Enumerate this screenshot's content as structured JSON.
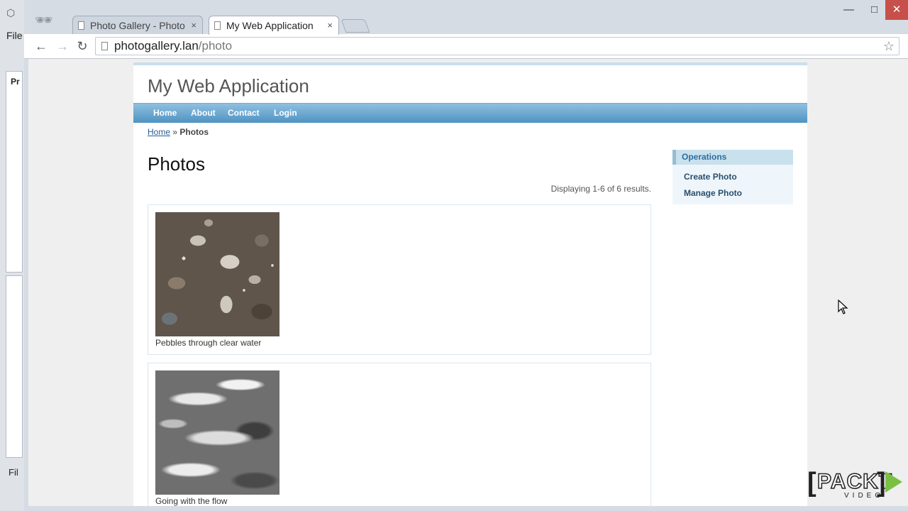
{
  "background_app": {
    "menu_file": "File",
    "panel_label": "Pr",
    "bottom_label": "Fil"
  },
  "browser": {
    "tabs": [
      {
        "title": "Photo Gallery - Photo",
        "active": false
      },
      {
        "title": "My Web Application",
        "active": true
      }
    ],
    "tab_close": "×",
    "url_host": "photogallery.lan",
    "url_path": "/photo"
  },
  "site": {
    "title": "My Web Application",
    "menu": [
      "Home",
      "About",
      "Contact",
      "Login"
    ],
    "breadcrumb": {
      "home": "Home",
      "separator": "»",
      "current": "Photos"
    }
  },
  "content": {
    "heading": "Photos",
    "summary": "Displaying 1-6 of 6 results.",
    "photos": [
      {
        "caption": "Pebbles through clear water"
      },
      {
        "caption": "Going with the flow"
      }
    ]
  },
  "sidebar": {
    "title": "Operations",
    "items": [
      "Create Photo",
      "Manage Photo"
    ]
  },
  "watermark": {
    "brand": "PACKT",
    "sub": "VIDEO",
    "accent": "#7ac143"
  },
  "colors": {
    "menu_bar": "#4f93c2",
    "sidebar_title": "#c9e0ed",
    "link": "#2a5e8f"
  }
}
